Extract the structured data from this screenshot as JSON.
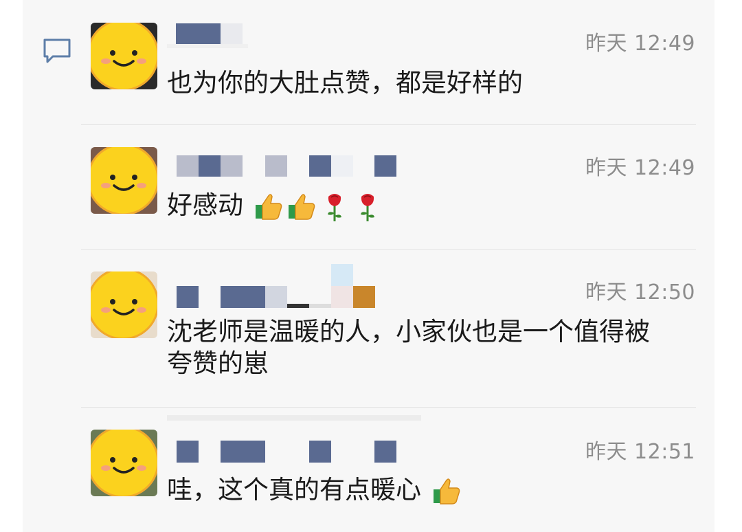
{
  "comments": [
    {
      "time": "昨天 12:49",
      "text": "也为你的大肚点赞，都是好样的"
    },
    {
      "time": "昨天 12:49",
      "text": "好感动"
    },
    {
      "time": "昨天 12:50",
      "text_line1": "沈老师是温暖的人，小家伙也是一个值得被",
      "text_line2": "夸赞的崽"
    },
    {
      "time": "昨天 12:51",
      "text": "哇，这个真的有点暖心"
    }
  ],
  "icons": {
    "comment": "comment-bubble-icon",
    "avatar": "smiley-face-icon",
    "thumbs_up": "thumbs-up-icon",
    "rose": "rose-icon"
  }
}
